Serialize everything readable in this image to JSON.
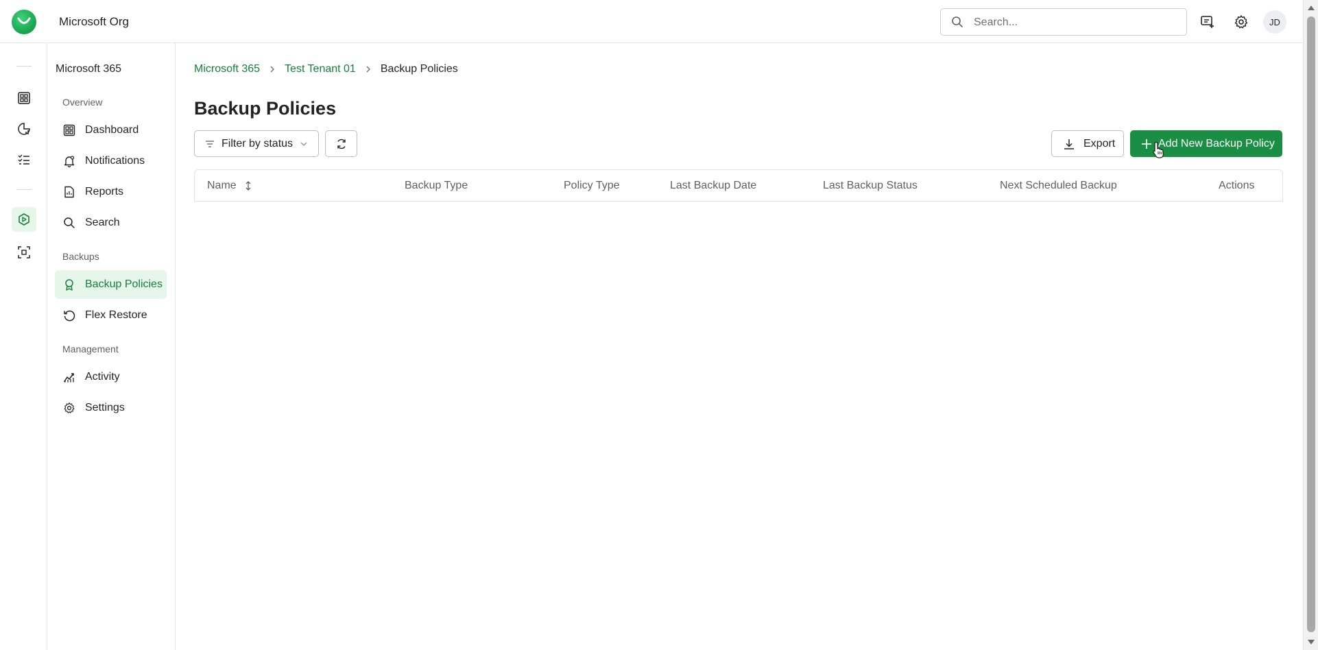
{
  "app": {
    "org_name": "Microsoft Org"
  },
  "header": {
    "search": {
      "placeholder": "Search...",
      "value": ""
    },
    "icons": [
      "chat-add-icon",
      "gear-icon"
    ],
    "avatar_initials": "JD"
  },
  "rail": {
    "icons": [
      "dashboard-icon",
      "reports-icon",
      "checklist-icon",
      "backup-hex-icon",
      "scan-icon"
    ],
    "active": "backup-hex-icon"
  },
  "sidebar": {
    "title": "Microsoft 365",
    "sections": [
      {
        "label": "Overview",
        "items": [
          {
            "label": "Dashboard",
            "icon": "dashboard-icon"
          },
          {
            "label": "Notifications",
            "icon": "bell-icon"
          },
          {
            "label": "Reports",
            "icon": "report-icon"
          },
          {
            "label": "Search",
            "icon": "search-icon"
          }
        ]
      },
      {
        "label": "Backups",
        "items": [
          {
            "label": "Backup Policies",
            "icon": "award-icon",
            "active": true
          },
          {
            "label": "Flex Restore",
            "icon": "restore-icon"
          }
        ]
      },
      {
        "label": "Management",
        "items": [
          {
            "label": "Activity",
            "icon": "activity-icon"
          },
          {
            "label": "Settings",
            "icon": "gear-icon"
          }
        ]
      }
    ]
  },
  "breadcrumb": [
    "Microsoft 365",
    "Test Tenant 01",
    "Backup Policies"
  ],
  "page": {
    "title": "Backup Policies"
  },
  "toolbar": {
    "filter_label": "Filter by status",
    "export_label": "Export",
    "add_label": "Add New Backup Policy"
  },
  "table": {
    "columns": [
      "Name",
      "Backup Type",
      "Policy Type",
      "Last Backup Date",
      "Last Backup Status",
      "Next Scheduled Backup",
      "Actions"
    ],
    "rows": []
  },
  "colors": {
    "accent": "#1a8f43",
    "accent_light": "#e6f6eb",
    "link": "#16803c"
  }
}
